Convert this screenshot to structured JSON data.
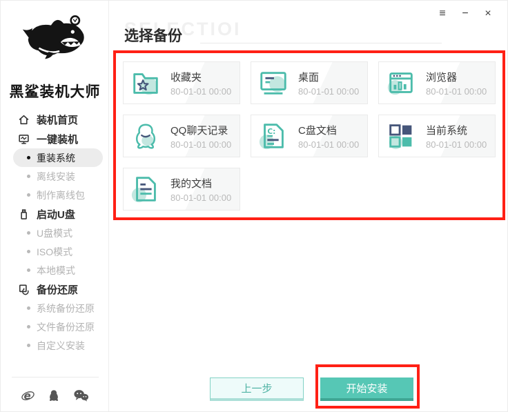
{
  "window": {
    "menu_glyph": "≡",
    "minimize_glyph": "−",
    "close_glyph": "×"
  },
  "sidebar": {
    "app_name": "黑鲨装机大师",
    "logo": "shark-logo",
    "items": [
      {
        "label": "装机首页",
        "icon": "home-icon",
        "level": "section",
        "state": "normal"
      },
      {
        "label": "一键装机",
        "icon": "monitor-icon",
        "level": "section",
        "state": "normal"
      },
      {
        "label": "重装系统",
        "level": "sub",
        "state": "active"
      },
      {
        "label": "离线安装",
        "level": "sub",
        "state": "disabled"
      },
      {
        "label": "制作离线包",
        "level": "sub",
        "state": "disabled"
      },
      {
        "label": "启动U盘",
        "icon": "usb-drive-icon",
        "level": "section",
        "state": "normal"
      },
      {
        "label": "U盘模式",
        "level": "sub",
        "state": "disabled"
      },
      {
        "label": "ISO模式",
        "level": "sub",
        "state": "disabled"
      },
      {
        "label": "本地模式",
        "level": "sub",
        "state": "disabled"
      },
      {
        "label": "备份还原",
        "icon": "backup-restore-icon",
        "level": "section",
        "state": "normal"
      },
      {
        "label": "系统备份还原",
        "level": "sub",
        "state": "disabled"
      },
      {
        "label": "文件备份还原",
        "level": "sub",
        "state": "disabled"
      },
      {
        "label": "自定义安装",
        "level": "sub",
        "state": "disabled"
      }
    ],
    "footer_icons": [
      "ie-browser-icon",
      "qq-icon",
      "wechat-icon"
    ]
  },
  "main": {
    "title": "选择备份",
    "watermark": "SELECTIOI",
    "c_drive_icon_label": "C:",
    "cards": [
      {
        "title": "收藏夹",
        "date": "80-01-01 00:00",
        "icon": "favorites-folder-icon"
      },
      {
        "title": "桌面",
        "date": "80-01-01 00:00",
        "icon": "desktop-icon"
      },
      {
        "title": "浏览器",
        "date": "80-01-01 00:00",
        "icon": "browser-icon"
      },
      {
        "title": "QQ聊天记录",
        "date": "80-01-01 00:00",
        "icon": "qq-chat-icon"
      },
      {
        "title": "C盘文档",
        "date": "80-01-01 00:00",
        "icon": "c-drive-document-icon"
      },
      {
        "title": "当前系统",
        "date": "80-01-01 00:00",
        "icon": "current-system-icon"
      },
      {
        "title": "我的文档",
        "date": "80-01-01 00:00",
        "icon": "my-documents-icon"
      }
    ],
    "buttons": {
      "back": "上一步",
      "install": "开始安装"
    }
  },
  "colors": {
    "teal": "#4cbcab",
    "teal_light": "#c3e7e0",
    "navy": "#46567a",
    "annotation_red": "#ff2015",
    "disabled_gray": "#b3b3b3"
  }
}
